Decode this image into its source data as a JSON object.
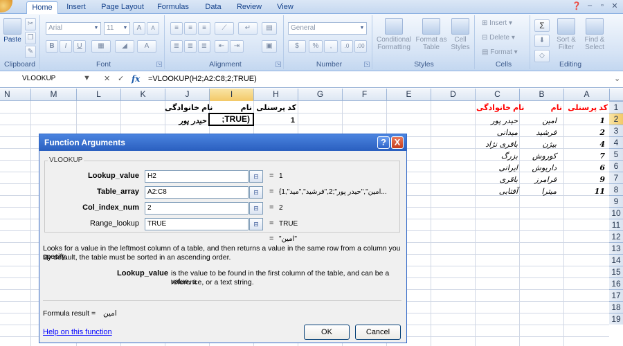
{
  "ribbon": {
    "tabs": [
      "Home",
      "Insert",
      "Page Layout",
      "Formulas",
      "Data",
      "Review",
      "View"
    ],
    "clipboard": {
      "paste": "Paste",
      "group": "Clipboard"
    },
    "font": {
      "name": "Arial",
      "size": "11",
      "group": "Font",
      "bold": "B",
      "italic": "I",
      "underline": "U",
      "grow": "A",
      "shrink": "A"
    },
    "alignment": {
      "group": "Alignment"
    },
    "number": {
      "format": "General",
      "percent": "%",
      "group": "Number"
    },
    "styles": {
      "conditional": "Conditional Formatting",
      "as_table": "Format as Table",
      "cell_styles": "Cell Styles",
      "group": "Styles"
    },
    "cells": {
      "insert": "Insert",
      "delete": "Delete",
      "format": "Format",
      "group": "Cells"
    },
    "editing": {
      "sort": "Sort & Filter",
      "find": "Find & Select",
      "group": "Editing"
    }
  },
  "formula_bar": {
    "name_box": "VLOOKUP",
    "fx": "fx",
    "formula": "=VLOOKUP(H2;A2:C8;2;TRUE)"
  },
  "columns": [
    "N",
    "M",
    "L",
    "K",
    "J",
    "I",
    "H",
    "G",
    "F",
    "E",
    "D",
    "C",
    "B",
    "A"
  ],
  "rows": [
    "1",
    "2",
    "3",
    "4",
    "5",
    "6",
    "7",
    "8",
    "9",
    "10",
    "11",
    "12",
    "13",
    "14",
    "15",
    "16",
    "17",
    "18",
    "19"
  ],
  "headers_right": {
    "a": "کد پرسنلی",
    "b": "نام",
    "c": "نام خانوادگی"
  },
  "table": [
    {
      "a": "1",
      "b": "امین",
      "c": "حیدر پور"
    },
    {
      "a": "2",
      "b": "فرشید",
      "c": "میدانی"
    },
    {
      "a": "4",
      "b": "بیژن",
      "c": "باقری نژاد"
    },
    {
      "a": "7",
      "b": "کوروش",
      "c": "بزرگ"
    },
    {
      "a": "6",
      "b": "داریوش",
      "c": "ایرانی"
    },
    {
      "a": "9",
      "b": "فرامرز",
      "c": "باقری"
    },
    {
      "a": "11",
      "b": "میترا",
      "c": "آفتابی"
    }
  ],
  "lookup_area": {
    "h_header": "کد پرسنلی",
    "i_header": "نام",
    "j_header": "نام خانوادگی",
    "h_value": "1",
    "i_value": ";TRUE)",
    "j_value": "حیدر پور"
  },
  "dialog": {
    "title": "Function Arguments",
    "help_btn": "?",
    "close_btn": "X",
    "function_name": "VLOOKUP",
    "args": [
      {
        "label": "Lookup_value",
        "value": "H2",
        "result": "1"
      },
      {
        "label": "Table_array",
        "value": "A2:C8",
        "result": "{1,\"امین\",\"حیدر پور\";2,\"فرشید\",\"مید..."
      },
      {
        "label": "Col_index_num",
        "value": "2",
        "result": "2"
      },
      {
        "label": "Range_lookup",
        "value": "TRUE",
        "result": "TRUE"
      }
    ],
    "equals": "=",
    "function_result": "\"امین\"",
    "description": "Looks for a value in the leftmost column of a table, and then returns a value in the same row from a column you specify.",
    "description2": "By default, the table must be sorted in an ascending order.",
    "arg_name": "Lookup_value",
    "arg_desc1": "is the value to be found in the first column of the table, and can be a value, a",
    "arg_desc2": "reference, or a text string.",
    "formula_result_label": "Formula result =",
    "formula_result_value": "امین",
    "help_link": "Help on this function",
    "ok": "OK",
    "cancel": "Cancel"
  }
}
